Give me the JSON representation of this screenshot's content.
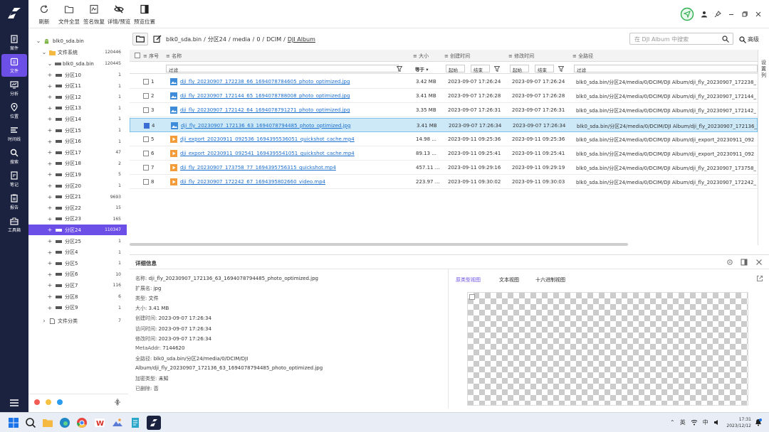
{
  "rail": {
    "items": [
      {
        "label": "案件",
        "icon": "case-icon"
      },
      {
        "label": "文件",
        "icon": "file-icon",
        "active": true
      },
      {
        "label": "分析",
        "icon": "analysis-icon"
      },
      {
        "label": "位置",
        "icon": "location-icon"
      },
      {
        "label": "时间线",
        "icon": "timeline-icon"
      },
      {
        "label": "搜索",
        "icon": "search-icon"
      },
      {
        "label": "笔记",
        "icon": "note-icon"
      },
      {
        "label": "报告",
        "icon": "report-icon"
      },
      {
        "label": "工具箱",
        "icon": "toolbox-icon"
      }
    ]
  },
  "toolbar": {
    "buttons": [
      {
        "label": "刷新",
        "icon": "refresh-icon"
      },
      {
        "label": "文件全显",
        "icon": "folder-icon"
      },
      {
        "label": "签名恢复",
        "icon": "signature-icon"
      },
      {
        "label": "详情/预览",
        "icon": "eye-slash-icon"
      },
      {
        "label": "预览位置",
        "icon": "layout-icon"
      }
    ]
  },
  "tree": {
    "root": {
      "name": "blk0_sda.bin"
    },
    "fs": {
      "name": "文件系统",
      "count": "120446"
    },
    "disk": {
      "name": "blk0_sda.bin",
      "count": "120445"
    },
    "partitions": [
      {
        "name": "分区10",
        "count": "1"
      },
      {
        "name": "分区11",
        "count": "1"
      },
      {
        "name": "分区12",
        "count": "1"
      },
      {
        "name": "分区13",
        "count": "1"
      },
      {
        "name": "分区14",
        "count": "1"
      },
      {
        "name": "分区15",
        "count": "1"
      },
      {
        "name": "分区16",
        "count": "1"
      },
      {
        "name": "分区17",
        "count": "47"
      },
      {
        "name": "分区18",
        "count": "2"
      },
      {
        "name": "分区19",
        "count": "5"
      },
      {
        "name": "分区20",
        "count": "1"
      },
      {
        "name": "分区21",
        "count": "9693"
      },
      {
        "name": "分区22",
        "count": "15"
      },
      {
        "name": "分区23",
        "count": "165"
      },
      {
        "name": "分区24",
        "count": "110347",
        "selected": true
      },
      {
        "name": "分区25",
        "count": "1"
      },
      {
        "name": "分区4",
        "count": "1"
      },
      {
        "name": "分区5",
        "count": "1"
      },
      {
        "name": "分区6",
        "count": "10"
      },
      {
        "name": "分区7",
        "count": "116"
      },
      {
        "name": "分区8",
        "count": "6"
      },
      {
        "name": "分区9",
        "count": "1"
      }
    ],
    "category": {
      "name": "文件分类",
      "count": "7"
    }
  },
  "path": {
    "segments": [
      "blk0_sda.bin",
      "分区24",
      "media",
      "0",
      "DCIM",
      "DJI Album"
    ],
    "sep": "/",
    "search_placeholder": "在 DJI Album 中搜索",
    "advanced": "高级"
  },
  "table": {
    "headers": {
      "index": "序号",
      "name": "名称",
      "size": "大小",
      "ctime": "创建时间",
      "mtime": "修改时间",
      "path": "全路径"
    },
    "filters": {
      "name": "过滤",
      "size": "等于",
      "c_start": "起始",
      "c_end": "结束",
      "m_start": "起始",
      "m_end": "结束",
      "path": "过滤"
    },
    "settings_label": "设置列",
    "rows": [
      {
        "idx": "1",
        "name": "dji_fly_20230907_172238_66_1694078784605_photo_optimized.jpg",
        "type": "image",
        "size": "3.42 MB",
        "ctime": "2023-09-07 17:26:24",
        "mtime": "2023-09-07 17:26:24",
        "path": "blk0_sda.bin/分区24/media/0/DCIM/DJI Album/dji_fly_20230907_172238_"
      },
      {
        "idx": "2",
        "name": "dji_fly_20230907_172144_65_1694078788008_photo_optimized.jpg",
        "type": "image",
        "size": "3.41 MB",
        "ctime": "2023-09-07 17:26:28",
        "mtime": "2023-09-07 17:26:28",
        "path": "blk0_sda.bin/分区24/media/0/DCIM/DJI Album/dji_fly_20230907_172144_"
      },
      {
        "idx": "3",
        "name": "dji_fly_20230907_172142_64_1694078791271_photo_optimized.jpg",
        "type": "image",
        "size": "3.35 MB",
        "ctime": "2023-09-07 17:26:31",
        "mtime": "2023-09-07 17:26:31",
        "path": "blk0_sda.bin/分区24/media/0/DCIM/DJI Album/dji_fly_20230907_172142_"
      },
      {
        "idx": "4",
        "name": "dji_fly_20230907_172136_63_1694078794485_photo_optimized.jpg",
        "type": "image",
        "size": "3.41 MB",
        "ctime": "2023-09-07 17:26:34",
        "mtime": "2023-09-07 17:26:34",
        "path": "blk0_sda.bin/分区24/media/0/DCIM/DJI Album/dji_fly_20230907_172136_",
        "selected": true
      },
      {
        "idx": "5",
        "name": "dji_export_20230911_092536_1694395536051_quickshot_cache.mp4",
        "type": "video",
        "size": "14.98 ...",
        "ctime": "2023-09-11 09:25:36",
        "mtime": "2023-09-11 09:25:36",
        "path": "blk0_sda.bin/分区24/media/0/DCIM/DJI Album/dji_export_20230911_092"
      },
      {
        "idx": "6",
        "name": "dji_export_20230911_092541_1694395541051_quickshot_cache.mp4",
        "type": "video",
        "size": "89.13 ...",
        "ctime": "2023-09-11 09:25:41",
        "mtime": "2023-09-11 09:25:41",
        "path": "blk0_sda.bin/分区24/media/0/DCIM/DJI Album/dji_export_20230911_092"
      },
      {
        "idx": "7",
        "name": "dji_fly_20230907_173758_77_1694395756315_quickshot.mp4",
        "type": "video",
        "size": "457.11 ...",
        "ctime": "2023-09-11 09:29:16",
        "mtime": "2023-09-11 09:29:19",
        "path": "blk0_sda.bin/分区24/media/0/DCIM/DJI Album/dji_fly_20230907_173758_"
      },
      {
        "idx": "8",
        "name": "dji_fly_20230907_172242_67_1694395802660_video.mp4",
        "type": "video",
        "size": "223.97 ...",
        "ctime": "2023-09-11 09:30:02",
        "mtime": "2023-09-11 09:30:03",
        "path": "blk0_sda.bin/分区24/media/0/DCIM/DJI Album/dji_fly_20230907_172242_"
      }
    ]
  },
  "details": {
    "title": "详细信息",
    "lines": [
      {
        "k": "名称:",
        "v": "dji_fly_20230907_172136_63_1694078794485_photo_optimized.jpg"
      },
      {
        "k": "扩展名:",
        "v": "jpg"
      },
      {
        "k": "类型:",
        "v": "文件"
      },
      {
        "k": "大小:",
        "v": "3.41 MB"
      },
      {
        "k": "创建时间:",
        "v": "2023-09-07 17:26:34"
      },
      {
        "k": "访问时间:",
        "v": "2023-09-07 17:26:34"
      },
      {
        "k": "修改时间:",
        "v": "2023-09-07 17:26:34"
      },
      {
        "k": "MetaAddr:",
        "v": "7144620"
      },
      {
        "k": "全路径:",
        "v": "blk0_sda.bin/分区24/media/0/DCIM/DJI"
      },
      {
        "k": "",
        "v": "Album/dji_fly_20230907_172136_63_1694078794485_photo_optimized.jpg"
      },
      {
        "k": "加密类型:",
        "v": "未知"
      },
      {
        "k": "已删除:",
        "v": "否"
      }
    ],
    "tabs": [
      "原类型视图",
      "文本视图",
      "十六进制视图"
    ]
  },
  "taskbar": {
    "time": "17:31",
    "date": "2023/12/12",
    "ime1": "英",
    "ime2": "中"
  },
  "colors": {
    "accent": "#6c4fe6",
    "rail": "#1b2240",
    "link": "#1a6fcf",
    "selected_row": "#cde8f7"
  }
}
